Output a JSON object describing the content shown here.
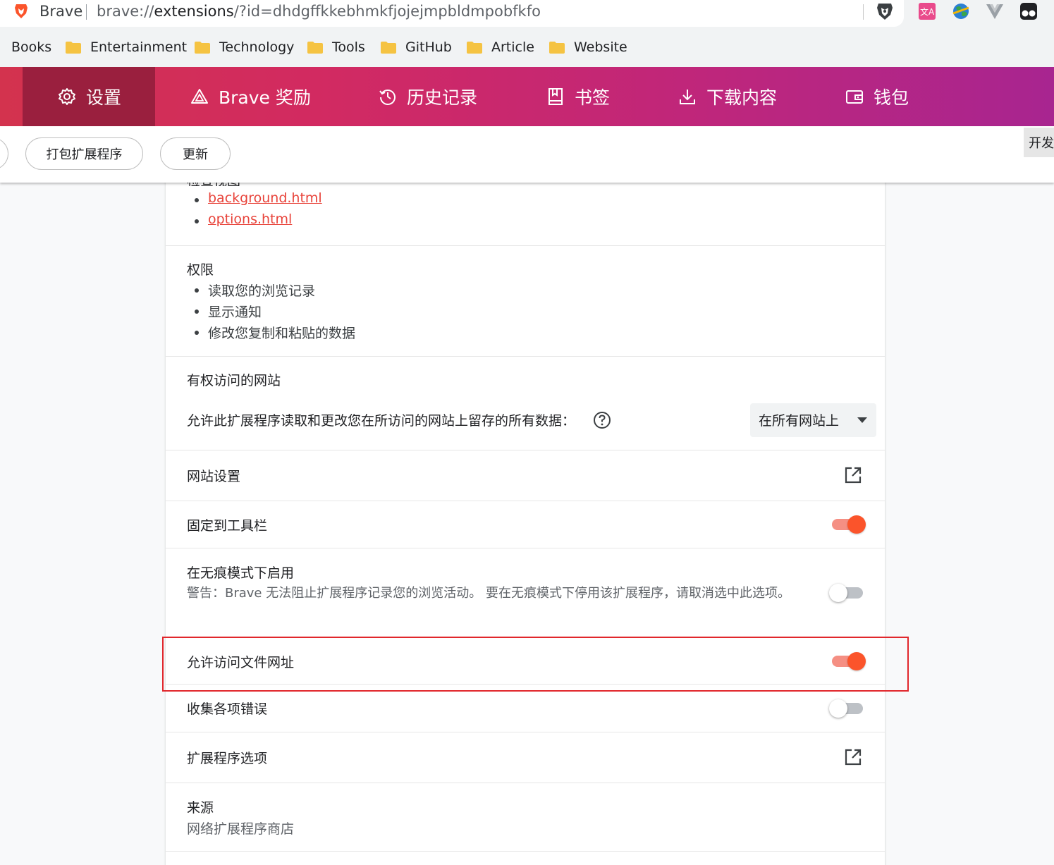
{
  "browser": {
    "site_name": "Brave",
    "url_prefix": "brave://",
    "url_host": "extensions",
    "url_rest": "/?id=dhdgffkkebhmkfjojejmpbldmpobfkfo"
  },
  "bookmarks": [
    "Books",
    "Entertainment",
    "Technology",
    "Tools",
    "GitHub",
    "Article",
    "Website"
  ],
  "nav": {
    "settings": "设置",
    "rewards": "Brave 奖励",
    "history": "历史记录",
    "bookmarks": "书签",
    "downloads": "下载内容",
    "wallet": "钱包"
  },
  "toolbar": {
    "pack_label": "打包扩展程序",
    "update_label": "更新",
    "dev_mode_label": "开发"
  },
  "details": {
    "views": {
      "partial_heading": "检查视图",
      "items": [
        "background.html",
        "options.html"
      ]
    },
    "permissions": {
      "heading": "权限",
      "items": [
        "读取您的浏览记录",
        "显示通知",
        "修改您复制和粘贴的数据"
      ]
    },
    "site_access": {
      "heading": "有权访问的网站",
      "description": "允许此扩展程序读取和更改您在所访问的网站上留存的所有数据：",
      "selected": "在所有网站上"
    },
    "site_settings": {
      "label": "网站设置"
    },
    "pin_toolbar": {
      "label": "固定到工具栏",
      "enabled": true
    },
    "incognito": {
      "label": "在无痕模式下启用",
      "warning": "警告：Brave 无法阻止扩展程序记录您的浏览活动。 要在无痕模式下停用该扩展程序，请取消选中此选项。",
      "enabled": false
    },
    "file_urls": {
      "label": "允许访问文件网址",
      "enabled": true
    },
    "collect_errors": {
      "label": "收集各项错误",
      "enabled": false
    },
    "extension_options": {
      "label": "扩展程序选项"
    },
    "source": {
      "heading": "来源",
      "value": "网络扩展程序商店"
    }
  },
  "colors": {
    "accent": "#fb542b",
    "nav_gradient_start": "#d3334e",
    "nav_gradient_end": "#a82590",
    "highlight_box": "#e1272c",
    "link": "#e8433a"
  }
}
